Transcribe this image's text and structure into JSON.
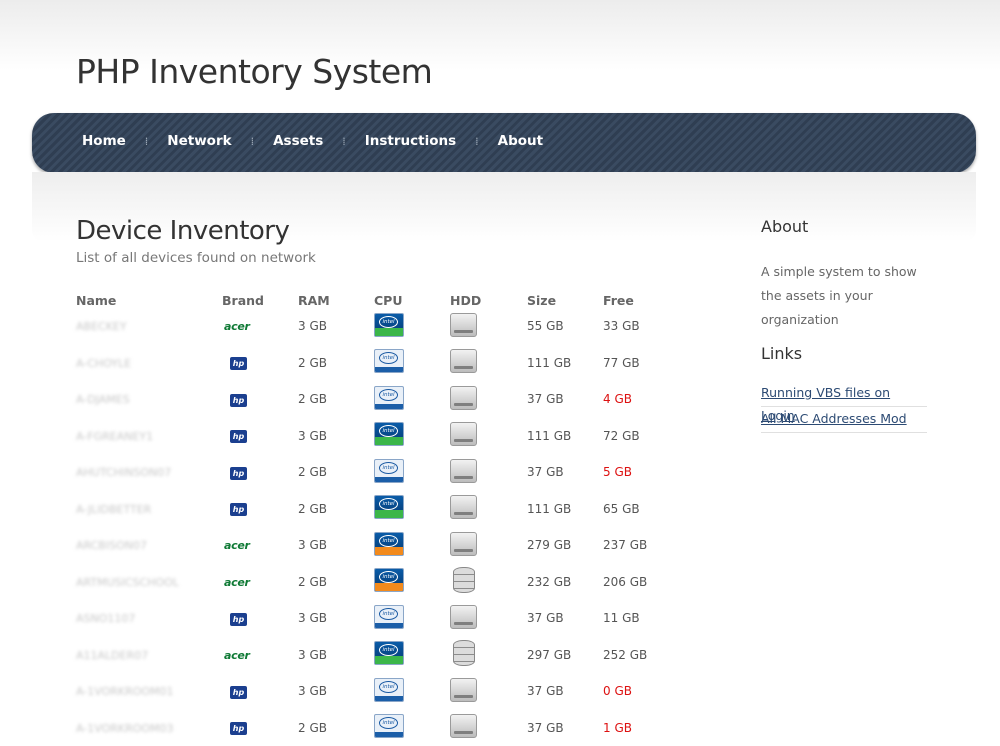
{
  "site": {
    "title": "PHP Inventory System"
  },
  "nav": {
    "items": [
      {
        "label": "Home"
      },
      {
        "label": "Network"
      },
      {
        "label": "Assets"
      },
      {
        "label": "Instructions"
      },
      {
        "label": "About"
      }
    ]
  },
  "main": {
    "title": "Device Inventory",
    "subtitle": "List of all devices found on network",
    "columns": [
      "Name",
      "Brand",
      "RAM",
      "CPU",
      "HDD",
      "Size",
      "Free"
    ],
    "rows": [
      {
        "name": "ABECKEY",
        "brand": "acer",
        "ram": "3 GB",
        "cpu": "core2",
        "hdd": "flat",
        "size": "55 GB",
        "free": "33 GB",
        "low": false
      },
      {
        "name": "A-CHOYLE",
        "brand": "hp",
        "ram": "2 GB",
        "cpu": "pentium",
        "hdd": "flat",
        "size": "111 GB",
        "free": "77 GB",
        "low": false
      },
      {
        "name": "A-DJAMES",
        "brand": "hp",
        "ram": "2 GB",
        "cpu": "pentium",
        "hdd": "flat",
        "size": "37 GB",
        "free": "4 GB",
        "low": true
      },
      {
        "name": "A-FGREANEY1",
        "brand": "hp",
        "ram": "3 GB",
        "cpu": "core2",
        "hdd": "flat",
        "size": "111 GB",
        "free": "72 GB",
        "low": false
      },
      {
        "name": "AHUTCHINSON07",
        "brand": "hp",
        "ram": "2 GB",
        "cpu": "pentium",
        "hdd": "flat",
        "size": "37 GB",
        "free": "5 GB",
        "low": true
      },
      {
        "name": "A-JLIDBETTER",
        "brand": "hp",
        "ram": "2 GB",
        "cpu": "core2",
        "hdd": "flat",
        "size": "111 GB",
        "free": "65 GB",
        "low": false
      },
      {
        "name": "ARCBISON07",
        "brand": "acer",
        "ram": "3 GB",
        "cpu": "corei3",
        "hdd": "flat",
        "size": "279 GB",
        "free": "237 GB",
        "low": false
      },
      {
        "name": "ARTMUSICSCHOOL",
        "brand": "acer",
        "ram": "2 GB",
        "cpu": "corei3",
        "hdd": "stack",
        "size": "232 GB",
        "free": "206 GB",
        "low": false
      },
      {
        "name": "ASNO1107",
        "brand": "hp",
        "ram": "3 GB",
        "cpu": "pentium",
        "hdd": "flat",
        "size": "37 GB",
        "free": "11 GB",
        "low": false
      },
      {
        "name": "A11ALDER07",
        "brand": "acer",
        "ram": "3 GB",
        "cpu": "core2",
        "hdd": "stack",
        "size": "297 GB",
        "free": "252 GB",
        "low": false
      },
      {
        "name": "A-1VORKROOM01",
        "brand": "hp",
        "ram": "3 GB",
        "cpu": "pentium",
        "hdd": "flat",
        "size": "37 GB",
        "free": "0 GB",
        "low": true
      },
      {
        "name": "A-1VORKROOM03",
        "brand": "hp",
        "ram": "2 GB",
        "cpu": "pentium",
        "hdd": "flat",
        "size": "37 GB",
        "free": "1 GB",
        "low": true
      }
    ]
  },
  "sidebar": {
    "about": {
      "title": "About",
      "text": "A simple system to show the assets in your organization"
    },
    "links": {
      "title": "Links",
      "items": [
        {
          "label": "Running VBS files on Login"
        },
        {
          "label": "All MAC Addresses Mod"
        }
      ]
    }
  },
  "icons": {
    "brand": {
      "acer": "acer",
      "hp": "hp"
    },
    "cpu": {
      "core2": "intel core 2",
      "pentium": "intel pentium",
      "corei3": "intel core i3"
    },
    "hdd": {
      "flat": "hard-drive",
      "stack": "disk-stack"
    }
  },
  "colors": {
    "nav_bg": "#34455b",
    "free_low": "#dd1111",
    "link": "#2c4a73",
    "acer_green": "#0f7a35",
    "hp_blue": "#1b3f8f"
  }
}
